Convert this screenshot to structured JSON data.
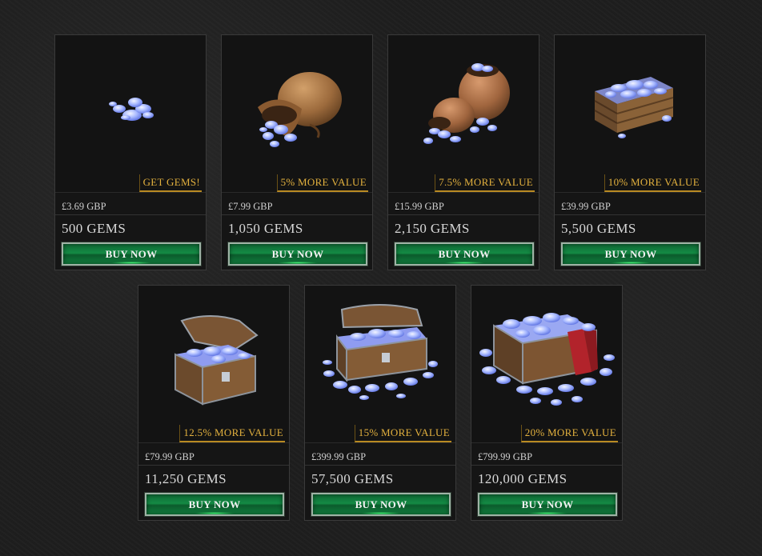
{
  "offers": [
    {
      "badge": "GET GEMS!",
      "price": "£3.69 GBP",
      "gems": "500 GEMS",
      "button": "BUY NOW",
      "image": "small-gem-pile"
    },
    {
      "badge": "5% MORE VALUE",
      "price": "£7.99 GBP",
      "gems": "1,050 GEMS",
      "button": "BUY NOW",
      "image": "gem-sack"
    },
    {
      "badge": "7.5% MORE VALUE",
      "price": "£15.99 GBP",
      "gems": "2,150 GEMS",
      "button": "BUY NOW",
      "image": "two-gem-sacks"
    },
    {
      "badge": "10% MORE VALUE",
      "price": "£39.99 GBP",
      "gems": "5,500 GEMS",
      "button": "BUY NOW",
      "image": "gem-crate"
    },
    {
      "badge": "12.5% MORE VALUE",
      "price": "£79.99 GBP",
      "gems": "11,250 GEMS",
      "button": "BUY NOW",
      "image": "gem-chest"
    },
    {
      "badge": "15% MORE VALUE",
      "price": "£399.99 GBP",
      "gems": "57,500 GEMS",
      "button": "BUY NOW",
      "image": "large-gem-chest"
    },
    {
      "badge": "20% MORE VALUE",
      "price": "£799.99 GBP",
      "gems": "120,000 GEMS",
      "button": "BUY NOW",
      "image": "gem-hoard"
    }
  ],
  "colors": {
    "badge_gold": "#e3b13e",
    "button_green": "#148a44",
    "gem_blue": "#8fa8ff"
  }
}
